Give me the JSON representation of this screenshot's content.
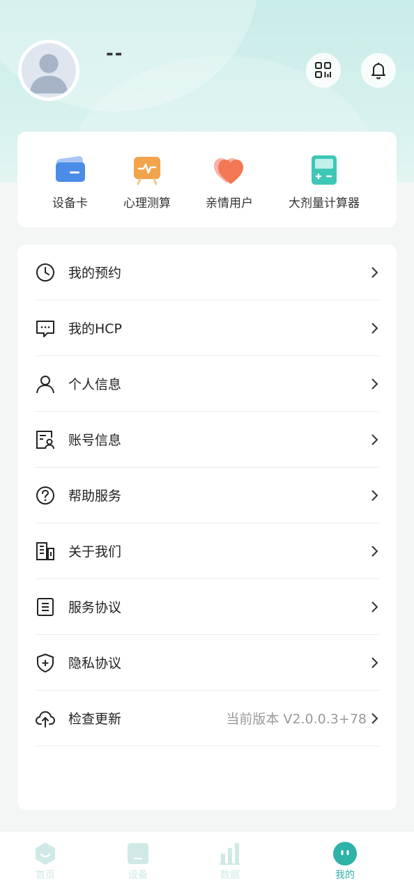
{
  "profile": {
    "username": "--"
  },
  "quick_actions": [
    {
      "label": "设备卡",
      "icon": "device-card-icon"
    },
    {
      "label": "心理测算",
      "icon": "psych-test-icon"
    },
    {
      "label": "亲情用户",
      "icon": "family-user-icon"
    },
    {
      "label": "大剂量计算器",
      "icon": "calculator-icon"
    }
  ],
  "menu": [
    {
      "label": "我的预约",
      "icon": "clock-icon"
    },
    {
      "label": "我的HCP",
      "icon": "chat-icon"
    },
    {
      "label": "个人信息",
      "icon": "person-icon"
    },
    {
      "label": "账号信息",
      "icon": "account-card-icon"
    },
    {
      "label": "帮助服务",
      "icon": "help-icon"
    },
    {
      "label": "关于我们",
      "icon": "building-icon"
    },
    {
      "label": "服务协议",
      "icon": "document-icon"
    },
    {
      "label": "隐私协议",
      "icon": "shield-icon"
    },
    {
      "label": "检查更新",
      "icon": "cloud-upload-icon",
      "value": "当前版本 V2.0.0.3+78"
    }
  ],
  "tabs": [
    {
      "label": "首页",
      "icon": "home-icon",
      "active": false
    },
    {
      "label": "设备",
      "icon": "device-icon",
      "active": false
    },
    {
      "label": "数据",
      "icon": "chart-icon",
      "active": false
    },
    {
      "label": "我的",
      "icon": "me-icon",
      "active": true
    }
  ],
  "colors": {
    "accent": "#2fb2a8",
    "inactive_tab": "#cfe9e6"
  }
}
